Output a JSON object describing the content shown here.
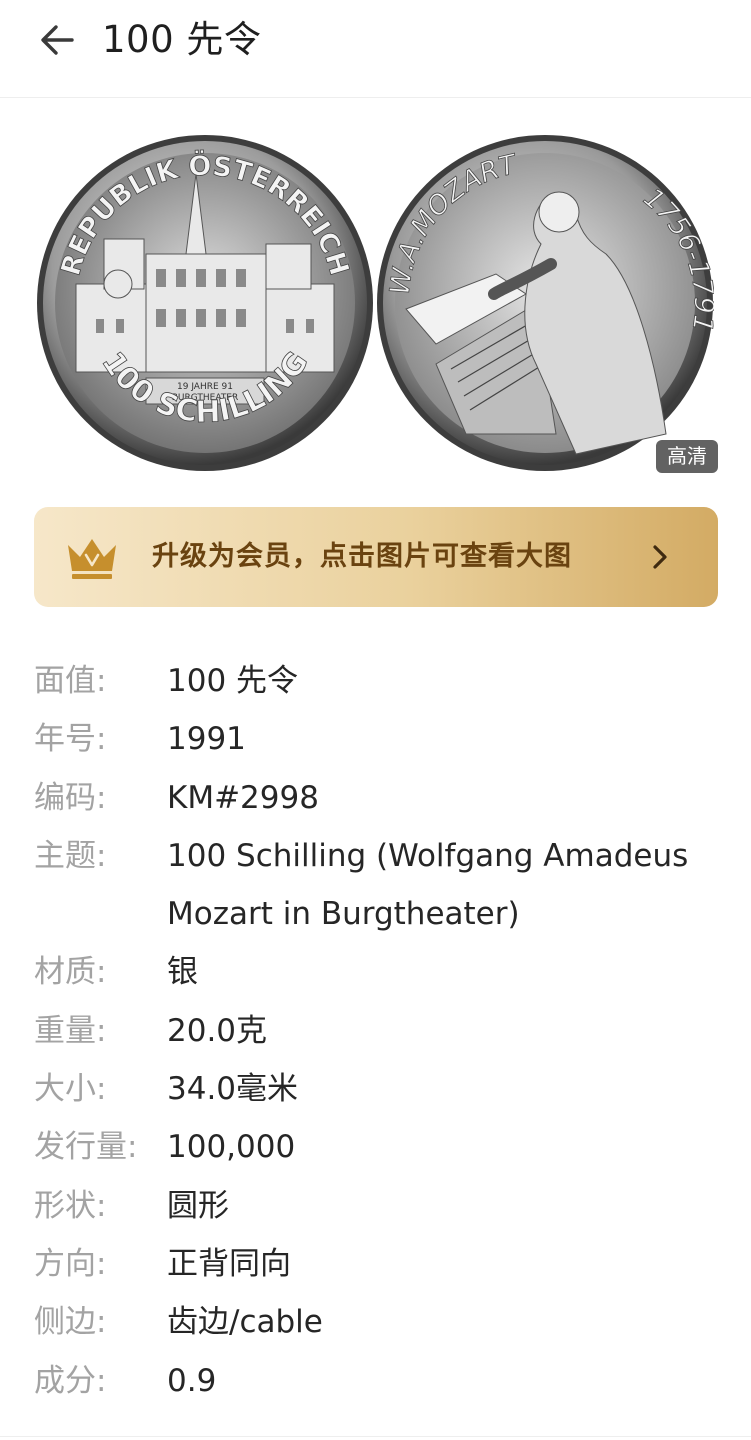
{
  "header": {
    "title": "100 先令",
    "back_icon": "arrow-left-icon"
  },
  "images": {
    "obverse": {
      "top_legend": "REPUBLIK ÖSTERREICH",
      "denomination": "100 SCHILLING",
      "plaque": "19 JAHRE 91 BURGTHEATER"
    },
    "reverse": {
      "name": "W.A.MOZART",
      "years": "1756-1791"
    },
    "hd_badge": "高清"
  },
  "vip_banner": {
    "text": "升级为会员，点击图片可查看大图",
    "icon": "crown-icon",
    "chevron": "chevron-right-icon"
  },
  "details": [
    {
      "label": "面值:",
      "value": "100 先令"
    },
    {
      "label": "年号:",
      "value": "1991"
    },
    {
      "label": "编码:",
      "value": "KM#2998"
    },
    {
      "label": "主题:",
      "value": "100 Schilling (Wolfgang Amadeus Mozart in Burgtheater)"
    },
    {
      "label": "材质:",
      "value": "银"
    },
    {
      "label": "重量:",
      "value": "20.0克"
    },
    {
      "label": "大小:",
      "value": "34.0毫米"
    },
    {
      "label": "发行量:",
      "value": "100,000"
    },
    {
      "label": "形状:",
      "value": "圆形"
    },
    {
      "label": "方向:",
      "value": "正背同向"
    },
    {
      "label": "侧边:",
      "value": "齿边/cable"
    },
    {
      "label": "成分:",
      "value": "0.9"
    }
  ],
  "colors": {
    "banner_text": "#6a4310",
    "label": "#a3a3a3",
    "value": "#262626"
  }
}
